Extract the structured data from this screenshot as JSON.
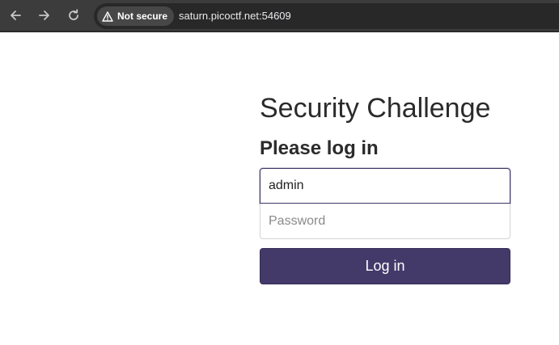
{
  "browser": {
    "back_icon": "arrow-left-icon",
    "forward_icon": "arrow-right-icon",
    "reload_icon": "reload-icon",
    "security_icon": "warning-triangle-icon",
    "security_label": "Not secure",
    "url": "saturn.picoctf.net:54609"
  },
  "login": {
    "title": "Security Challenge",
    "subtitle": "Please log in",
    "username_value": "admin",
    "password_placeholder": "Password",
    "submit_label": "Log in"
  },
  "colors": {
    "toolbar_bg": "#3c3c3c",
    "button_bg": "#433a6a",
    "focus_border": "#3b3466"
  }
}
